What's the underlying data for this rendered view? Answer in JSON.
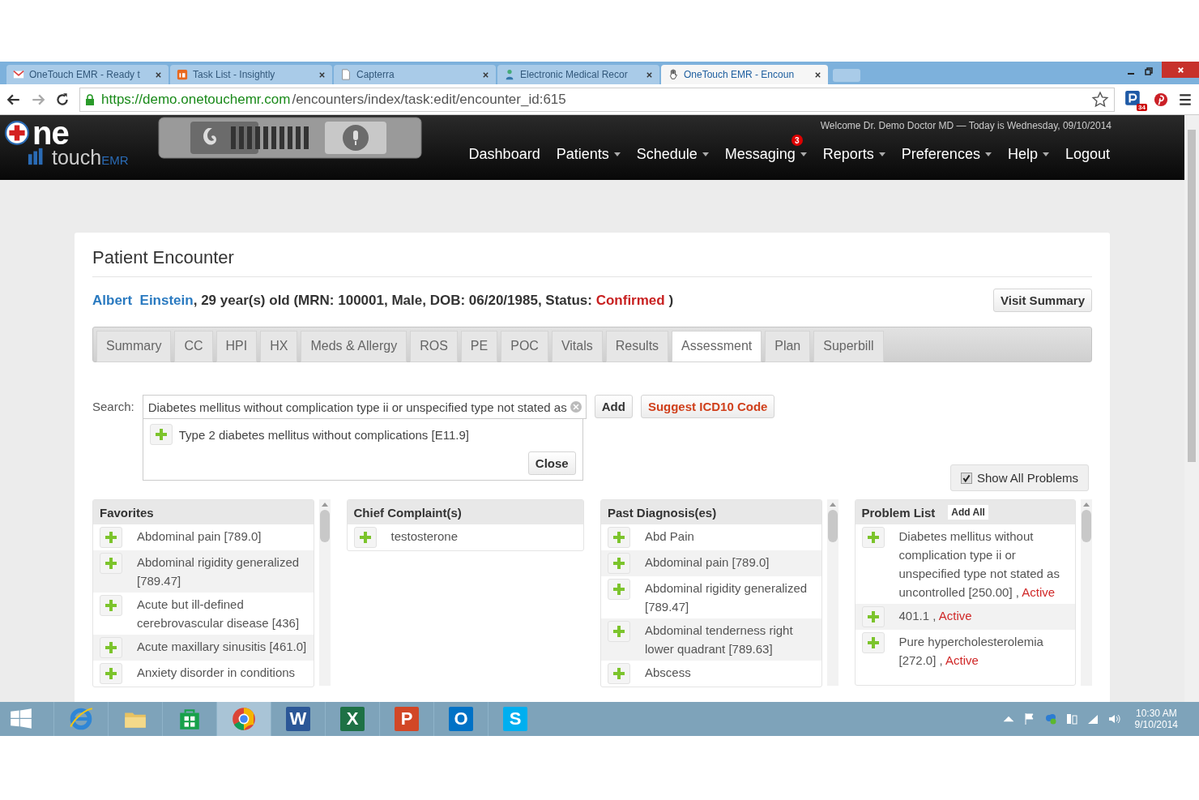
{
  "browser": {
    "tabs": [
      {
        "title": "OneTouch EMR - Ready t",
        "kind": "gmail",
        "selected": false
      },
      {
        "title": "Task List - Insightly",
        "kind": "insightly",
        "selected": false
      },
      {
        "title": "Capterra",
        "kind": "page",
        "selected": false
      },
      {
        "title": "Electronic Medical Recor",
        "kind": "doctor",
        "selected": false
      },
      {
        "title": "OneTouch EMR - Encoun",
        "kind": "hand",
        "selected": true
      }
    ],
    "url_host": "https://demo.onetouchemr.com",
    "url_path": "/encounters/index/task:edit/encounter_id:615",
    "extension_badge": "34"
  },
  "app": {
    "logo": {
      "big": "ne",
      "small": "touch",
      "suffix": "EMR"
    },
    "welcome": "Welcome Dr. Demo Doctor MD — Today is Wednesday, 09/10/2014",
    "nav": [
      {
        "label": "Dashboard",
        "dropdown": false
      },
      {
        "label": "Patients",
        "dropdown": true
      },
      {
        "label": "Schedule",
        "dropdown": true
      },
      {
        "label": "Messaging",
        "dropdown": true,
        "badge": "3"
      },
      {
        "label": "Reports",
        "dropdown": true
      },
      {
        "label": "Preferences",
        "dropdown": true
      },
      {
        "label": "Help",
        "dropdown": true
      },
      {
        "label": "Logout",
        "dropdown": false
      }
    ]
  },
  "encounter": {
    "title": "Patient Encounter",
    "patient": {
      "name": "Albert  Einstein",
      "details": ", 29 year(s) old (MRN: 100001, Male, DOB: 06/20/1985, Status: ",
      "status": "Confirmed",
      "closing": " )"
    },
    "visit_summary": "Visit Summary",
    "tabs": [
      {
        "label": "Summary",
        "selected": false
      },
      {
        "label": "CC",
        "selected": false
      },
      {
        "label": "HPI",
        "selected": false
      },
      {
        "label": "HX",
        "selected": false
      },
      {
        "label": "Meds & Allergy",
        "selected": false
      },
      {
        "label": "ROS",
        "selected": false
      },
      {
        "label": "PE",
        "selected": false
      },
      {
        "label": "POC",
        "selected": false
      },
      {
        "label": "Vitals",
        "selected": false
      },
      {
        "label": "Results",
        "selected": false
      },
      {
        "label": "Assessment",
        "selected": true
      },
      {
        "label": "Plan",
        "selected": false
      },
      {
        "label": "Superbill",
        "selected": false
      }
    ],
    "search": {
      "label": "Search:",
      "value": "Diabetes mellitus without complication type ii or unspecified type not stated as",
      "results": [
        "Type 2 diabetes mellitus without complications [E11.9]"
      ],
      "close": "Close"
    },
    "add": "Add",
    "suggest": "Suggest ICD10 Code",
    "show_all": {
      "label": "Show All Problems",
      "checked": true
    },
    "panels": [
      {
        "title": "Favorites",
        "scrollbar": true,
        "items": [
          {
            "text": "Abdominal pain [789.0]"
          },
          {
            "text": "Abdominal rigidity generalized [789.47]"
          },
          {
            "text": "Acute but ill-defined cerebrovascular disease [436]"
          },
          {
            "text": "Acute maxillary sinusitis [461.0]"
          },
          {
            "text": "Anxiety disorder in conditions"
          }
        ]
      },
      {
        "title": "Chief Complaint(s)",
        "scrollbar": false,
        "items": [
          {
            "text": "testosterone"
          }
        ]
      },
      {
        "title": "Past Diagnosis(es)",
        "scrollbar": true,
        "items": [
          {
            "text": "Abd Pain"
          },
          {
            "text": "Abdominal pain [789.0]"
          },
          {
            "text": "Abdominal rigidity generalized [789.47]"
          },
          {
            "text": "Abdominal tenderness right lower quadrant [789.63]"
          },
          {
            "text": "Abscess"
          }
        ]
      },
      {
        "title": "Problem List",
        "action": "Add All",
        "scrollbar": true,
        "items": [
          {
            "text": "Diabetes mellitus without complication type ii or unspecified type not stated as uncontrolled [250.00] , ",
            "status": "Active"
          },
          {
            "text": "401.1 , ",
            "status": "Active"
          },
          {
            "text": "Pure hypercholesterolemia [272.0] , ",
            "status": "Active"
          }
        ]
      }
    ]
  },
  "taskbar": {
    "apps": [
      {
        "kind": "ie",
        "selected": false
      },
      {
        "kind": "folder",
        "selected": false
      },
      {
        "kind": "store",
        "selected": false
      },
      {
        "kind": "chrome",
        "selected": true
      },
      {
        "kind": "letter",
        "glyph": "W",
        "color": "#2b5797",
        "selected": false
      },
      {
        "kind": "letter",
        "glyph": "X",
        "color": "#1e7145",
        "selected": false
      },
      {
        "kind": "letter",
        "glyph": "P",
        "color": "#d24726",
        "selected": false
      },
      {
        "kind": "letter",
        "glyph": "O",
        "color": "#0072c6",
        "selected": false
      },
      {
        "kind": "letter",
        "glyph": "S",
        "color": "#00aff0",
        "selected": false
      }
    ],
    "time": "10:30 AM",
    "date": "9/10/2014"
  }
}
